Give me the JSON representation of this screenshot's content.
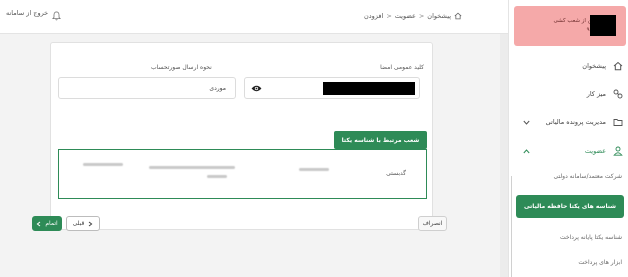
{
  "header": {
    "logout_label": "خروج از سامانه",
    "breadcrumb": [
      "پیشخوان",
      "عضویت",
      "افزودن"
    ],
    "breadcrumb_separator": ">"
  },
  "form": {
    "password_label": "کلید عمومی امضا",
    "method_label": "نحوه ارسال صورتحساب",
    "method_value": "موردی"
  },
  "branches": {
    "title": "شعب مرتبط با شناسه یکتا",
    "branch_name": "گدبستی"
  },
  "buttons": {
    "cancel": "انصراف",
    "previous": "قبلی",
    "finish": "اتمام"
  },
  "sidebar": {
    "user_line1": "میهن از شعب کشی",
    "user_line2": "پایه ۹",
    "items": [
      {
        "label": "پیشخوان",
        "icon": "home-icon"
      },
      {
        "label": "میز کار",
        "icon": "workspace-icon"
      },
      {
        "label": "مدیریت پرونده مالیاتی",
        "icon": "folder-icon"
      },
      {
        "label": "عضویت",
        "icon": "user-icon"
      }
    ],
    "sub_items": [
      "شرکت معتمد/سامانه دولتی",
      "شناسه های یکتا حافظه مالیاتی",
      "شناسه یکتا پایانه پرداخت",
      "ابزار های پرداخت"
    ]
  },
  "colors": {
    "accent": "#2e8b57",
    "user_box": "#f5a9a9"
  }
}
